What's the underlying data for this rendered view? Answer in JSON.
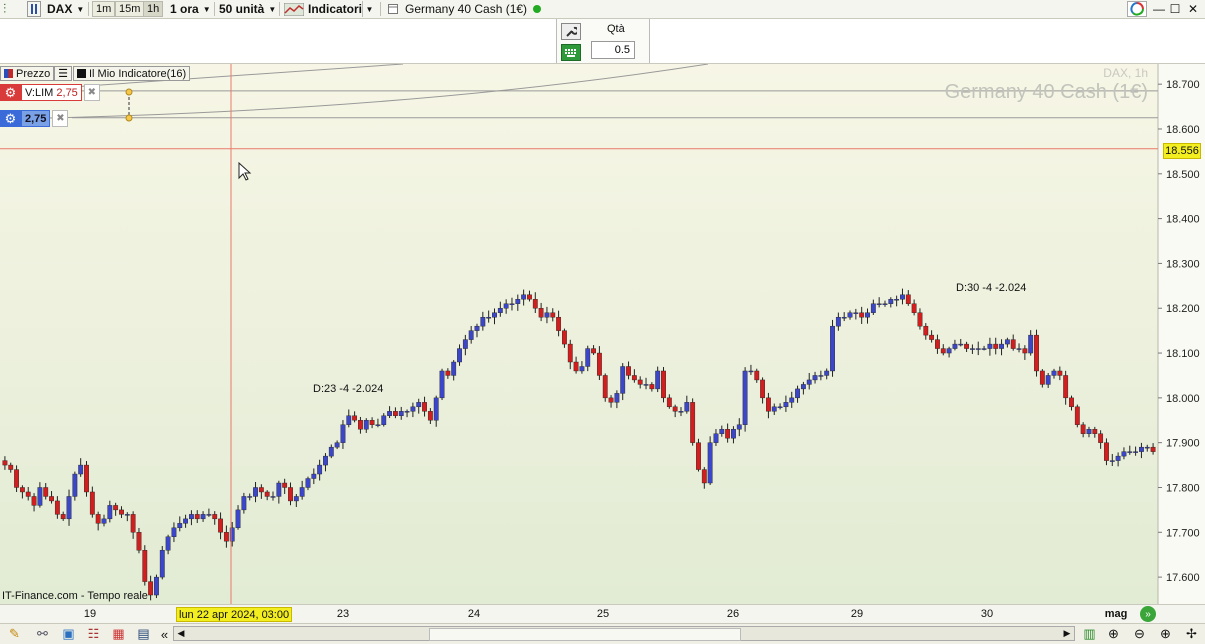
{
  "toolbar": {
    "symbol": "DAX",
    "timeframes": [
      "1m",
      "15m",
      "1h"
    ],
    "active_timeframe": "1h",
    "interval": "1 ora",
    "units": "50 unità",
    "indicators_label": "Indicatori",
    "instrument": "Germany 40 Cash (1€)"
  },
  "order": {
    "qty_label": "Qtà",
    "qty_value": "0.5"
  },
  "legend": {
    "price_label": "Prezzo",
    "indicator_label": "Il Mio Indicatore(16)"
  },
  "alerts": [
    {
      "label": "V:LIM",
      "value": "2,75",
      "color": "#d93a3a"
    },
    {
      "value": "2,75",
      "color": "#3a6bd9"
    }
  ],
  "watermark": {
    "symbol_tf": "DAX, 1h",
    "name": "Germany 40 Cash (1€)"
  },
  "current_price": "18.556",
  "annotations": [
    "D:23 -4 -2.024",
    "D:30 -4 -2.024"
  ],
  "source": "IT-Finance.com - Tempo reale",
  "crosshair_date": "lun 22 apr 2024, 03:00",
  "colors": {
    "up": "#3c46c8",
    "down": "#d21e1e",
    "crosshair": "#e87a6a",
    "bg_top": "#f7f6e6",
    "bg_bottom": "#e2ebd4"
  },
  "chart_data": {
    "type": "candlestick",
    "y_ticks": [
      "18.700",
      "18.600",
      "18.500",
      "18.400",
      "18.300",
      "18.200",
      "18.100",
      "18.000",
      "17.900",
      "17.800",
      "17.700",
      "17.600"
    ],
    "ylim": [
      17.54,
      18.745
    ],
    "x_labels": [
      "19",
      "23",
      "24",
      "25",
      "26",
      "29",
      "30",
      "mag"
    ],
    "crosshair_price": 18.556,
    "hlines": [
      18.685,
      18.625
    ],
    "candles": [
      17.85,
      17.84,
      17.8,
      17.79,
      17.78,
      17.76,
      17.8,
      17.78,
      17.77,
      17.74,
      17.73,
      17.78,
      17.83,
      17.85,
      17.79,
      17.74,
      17.72,
      17.73,
      17.76,
      17.75,
      17.74,
      17.74,
      17.7,
      17.66,
      17.59,
      17.56,
      17.6,
      17.66,
      17.69,
      17.71,
      17.72,
      17.73,
      17.74,
      17.73,
      17.74,
      17.74,
      17.73,
      17.7,
      17.68,
      17.71,
      17.75,
      17.78,
      17.78,
      17.8,
      17.79,
      17.78,
      17.78,
      17.81,
      17.8,
      17.77,
      17.78,
      17.8,
      17.82,
      17.83,
      17.85,
      17.87,
      17.89,
      17.9,
      17.94,
      17.96,
      17.95,
      17.93,
      17.95,
      17.94,
      17.94,
      17.96,
      17.97,
      17.96,
      17.97,
      17.97,
      17.98,
      17.99,
      17.97,
      17.95,
      18.0,
      18.06,
      18.05,
      18.08,
      18.11,
      18.13,
      18.15,
      18.16,
      18.18,
      18.18,
      18.19,
      18.2,
      18.21,
      18.21,
      18.22,
      18.23,
      18.22,
      18.2,
      18.18,
      18.19,
      18.18,
      18.15,
      18.12,
      18.08,
      18.06,
      18.07,
      18.11,
      18.1,
      18.05,
      18.0,
      17.99,
      18.01,
      18.07,
      18.05,
      18.04,
      18.03,
      18.03,
      18.02,
      18.06,
      18.0,
      17.98,
      17.97,
      17.97,
      17.99,
      17.9,
      17.84,
      17.81,
      17.9,
      17.92,
      17.93,
      17.91,
      17.93,
      17.94,
      18.06,
      18.06,
      18.04,
      18.0,
      17.97,
      17.98,
      17.98,
      17.99,
      18.0,
      18.02,
      18.03,
      18.04,
      18.05,
      18.05,
      18.06,
      18.16,
      18.18,
      18.18,
      18.19,
      18.19,
      18.18,
      18.19,
      18.21,
      18.21,
      18.21,
      18.22,
      18.22,
      18.23,
      18.21,
      18.19,
      18.16,
      18.14,
      18.13,
      18.11,
      18.1,
      18.11,
      18.12,
      18.12,
      18.11,
      18.11,
      18.11,
      18.11,
      18.12,
      18.11,
      18.12,
      18.13,
      18.11,
      18.11,
      18.1,
      18.14,
      18.06,
      18.03,
      18.05,
      18.06,
      18.05,
      18.0,
      17.98,
      17.94,
      17.92,
      17.93,
      17.92,
      17.9,
      17.86,
      17.86,
      17.87,
      17.88,
      17.88,
      17.88,
      17.89,
      17.89,
      17.88
    ]
  },
  "icons": [
    "wrench-icon",
    "keyboard-icon",
    "gear-icon",
    "recycle-icon",
    "zoom-in-icon",
    "zoom-out-icon",
    "crosshair-icon"
  ]
}
